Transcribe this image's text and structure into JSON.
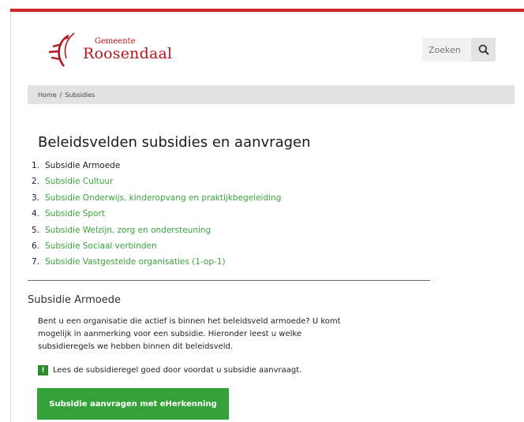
{
  "brand": {
    "small": "Gemeente",
    "name": "Roosendaal",
    "color": "#b3141c"
  },
  "search": {
    "placeholder": "Zoeken",
    "icon": "search-icon"
  },
  "breadcrumb": {
    "home": "Home",
    "separator": "/",
    "current": "Subsidies"
  },
  "page": {
    "title": "Beleidsvelden subsidies en aanvragen"
  },
  "fields": [
    {
      "num": "1.",
      "label": "Subsidie Armoede"
    },
    {
      "num": "2.",
      "label": "Subsidie Cultuur"
    },
    {
      "num": "3.",
      "label": "Subsidie Onderwijs, kinderopvang en praktijkbegeleiding"
    },
    {
      "num": "4.",
      "label": "Subsidie Sport"
    },
    {
      "num": "5.",
      "label": "Subsidie Welzijn, zorg en ondersteuning"
    },
    {
      "num": "6.",
      "label": "Subsidie Sociaal verbinden"
    },
    {
      "num": "7.",
      "label": "Subsidie Vastgestelde organisaties (1-op-1)"
    }
  ],
  "section": {
    "heading": "Subsidie Armoede",
    "intro": "Bent u een organisatie die actief is binnen het beleidsveld armoede? U komt mogelijk in aanmerking voor een subsidie. Hieronder leest u welke subsidieregels we hebben binnen dit beleidsveld.",
    "notice_badge": "!",
    "notice": "Lees de subsidieregel goed door voordat u subsidie aanvraagt.",
    "cta": "Subsidie aanvragen met eHerkenning"
  },
  "colors": {
    "accent_bar": "#d5232b",
    "link": "#3aa43a",
    "button": "#35a239"
  }
}
